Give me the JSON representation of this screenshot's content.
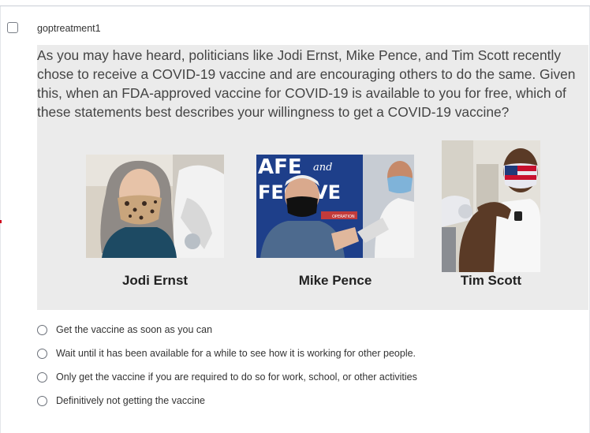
{
  "question": {
    "id": "goptreatment1",
    "text": "As you may have heard, politicians like Jodi Ernst, Mike Pence, and Tim Scott recently chose to receive a COVID-19 vaccine and are encouraging others to do the same. Given this, when an FDA-approved vaccine for COVID-19 is available to you for free, which of these statements best describes your willingness to get a COVID-19 vaccine?"
  },
  "photos": [
    {
      "caption": "Jodi Ernst"
    },
    {
      "caption": "Mike Pence",
      "sign_text_1": "AFE",
      "sign_text_2": "and",
      "sign_text_3": "FEC",
      "sign_text_4": "VE",
      "badge_text": "OPERATION"
    },
    {
      "caption": "Tim Scott"
    }
  ],
  "options": [
    {
      "label": "Get the vaccine as soon as you can"
    },
    {
      "label": "Wait until it has been available for a while to see how it is working for other people."
    },
    {
      "label": "Only get the vaccine if you are required to do so for work, school, or other activities"
    },
    {
      "label": "Definitively not getting the vaccine"
    }
  ],
  "colors": {
    "question_bg": "#ebebeb",
    "divider": "#c9ced6"
  }
}
